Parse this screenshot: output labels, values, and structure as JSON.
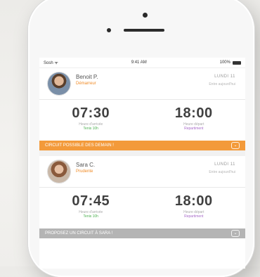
{
  "status_bar": {
    "carrier": "Sosh ᯤ",
    "time": "9:41 AM",
    "battery_pct": "100%"
  },
  "cards": [
    {
      "name": "Benoit P.",
      "role": "Démarreur",
      "date": "LUNDI 11",
      "subtitle": "Entre aujourd'hui",
      "start_time": "07:30",
      "start_label": "Heure d'arrivée",
      "start_sub": "Tenis 10h",
      "end_time": "18:00",
      "end_label": "Heure départ",
      "end_sub": "Repartiment",
      "banner": "CIRCUIT POSSIBLE DES DEMAIN !",
      "banner_color": "#f39a3a"
    },
    {
      "name": "Sara C.",
      "role": "Prudente",
      "date": "LUNDI 11",
      "subtitle": "Entre aujourd'hui",
      "start_time": "07:45",
      "start_label": "Heure d'arrivée",
      "start_sub": "Tenis 10h",
      "end_time": "18:00",
      "end_label": "Heure départ",
      "end_sub": "Repartiment",
      "banner": "PROPOSEZ UN CIRCUIT À SARA !",
      "banner_color": "#b4b4b4"
    }
  ],
  "icons": {
    "avatar": "user-photo",
    "chevron": "chevron-down-icon",
    "battery": "battery-icon"
  }
}
